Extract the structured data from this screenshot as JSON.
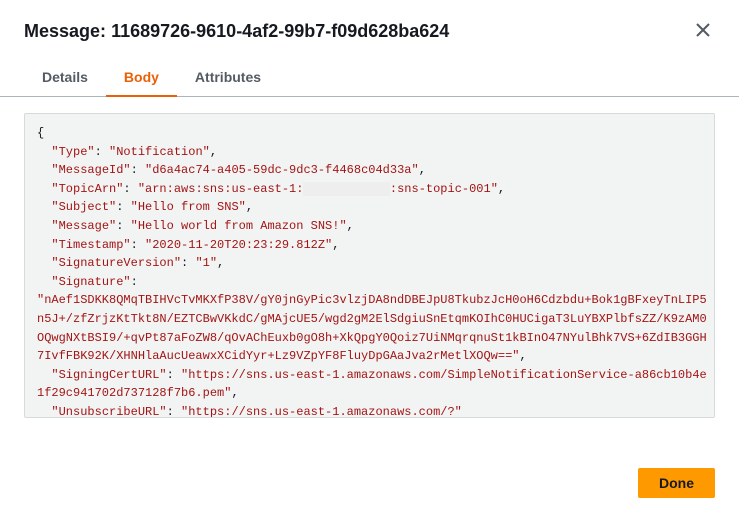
{
  "header": {
    "title_prefix": "Message:",
    "message_id": "11689726-9610-4af2-99b7-f09d628ba624"
  },
  "tabs": {
    "details": "Details",
    "body": "Body",
    "attributes": "Attributes",
    "active": "body"
  },
  "json_body": {
    "Type": "Notification",
    "MessageId": "d6a4ac74-a405-59dc-9dc3-f4468c04d33a",
    "TopicArn_prefix": "arn:aws:sns:us-east-1:",
    "TopicArn_redacted": "            ",
    "TopicArn_suffix": ":sns-topic-001",
    "Subject": "Hello from SNS",
    "Message": "Hello world from Amazon SNS!",
    "Timestamp": "2020-11-20T20:23:29.812Z",
    "SignatureVersion": "1",
    "Signature": "nAef1SDKK8QMqTBIHVcTvMKXfP38V/gY0jnGyPic3vlzjDA8ndDBEJpU8TkubzJcH0oH6Cdzbdu+Bok1gBFxeyTnLIP5n5J+/zfZrjzKtTkt8N/EZTCBwVKkdC/gMAjcUE5/wgd2gM2ElSdgiuSnEtqmKOIhC0HUCigaT3LuYBXPlbfsZZ/K9zAM0OQwgNXtBSI9/+qvPt87aFoZW8/qOvAChEuxb0gO8h+XkQpgY0Qoiz7UiNMqrqnuSt1kBInO47NYulBhk7VS+6ZdIB3GGH7IvfFBK92K/XHNHlaAucUeawxXCidYyr+Lz9VZpYF8FluyDpGAaJva2rMetlXOQw==",
    "SigningCertURL": "https://sns.us-east-1.amazonaws.com/SimpleNotificationService-a86cb10b4e1f29c941702d737128f7b6.pem",
    "UnsubscribeURL": "https://sns.us-east-1.amazonaws.com/?"
  },
  "footer": {
    "done_label": "Done"
  }
}
